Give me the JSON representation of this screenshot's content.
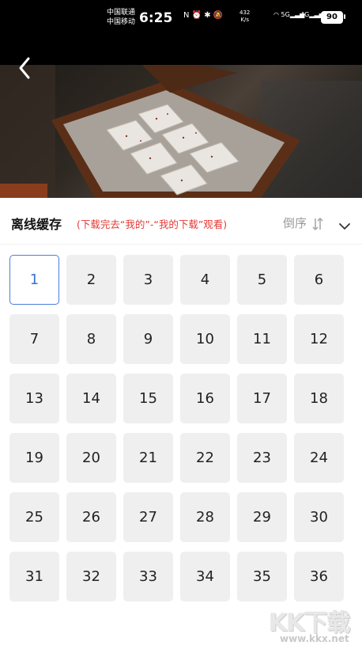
{
  "status_bar": {
    "carrier1": "中国联通",
    "carrier2": "中国移动",
    "time": "6:25",
    "icons": "N ⏰ ✱ 🔕",
    "speed_value": "432",
    "speed_unit": "K/s",
    "network1": "5G",
    "network2": "4G",
    "battery": "90"
  },
  "nav": {
    "back_icon": "back-arrow-icon"
  },
  "offline_cache": {
    "title": "离线缓存",
    "hint": "(下载完去“我的”-“我的下载”观看)",
    "sort_label": "倒序",
    "sort_icon": "sort-arrows-icon",
    "collapse_icon": "chevron-down-icon"
  },
  "episodes": {
    "selected": "1",
    "items": [
      "1",
      "2",
      "3",
      "4",
      "5",
      "6",
      "7",
      "8",
      "9",
      "10",
      "11",
      "12",
      "13",
      "14",
      "15",
      "16",
      "17",
      "18",
      "19",
      "20",
      "21",
      "22",
      "23",
      "24",
      "25",
      "26",
      "27",
      "28",
      "29",
      "30",
      "31",
      "32",
      "33",
      "34",
      "35",
      "36"
    ]
  },
  "watermark": {
    "logo": "KK下载",
    "url": "www.kkx.net"
  },
  "colors": {
    "accent": "#3b72d1",
    "hint_red": "#e53935",
    "tile_bg": "#efefef"
  }
}
